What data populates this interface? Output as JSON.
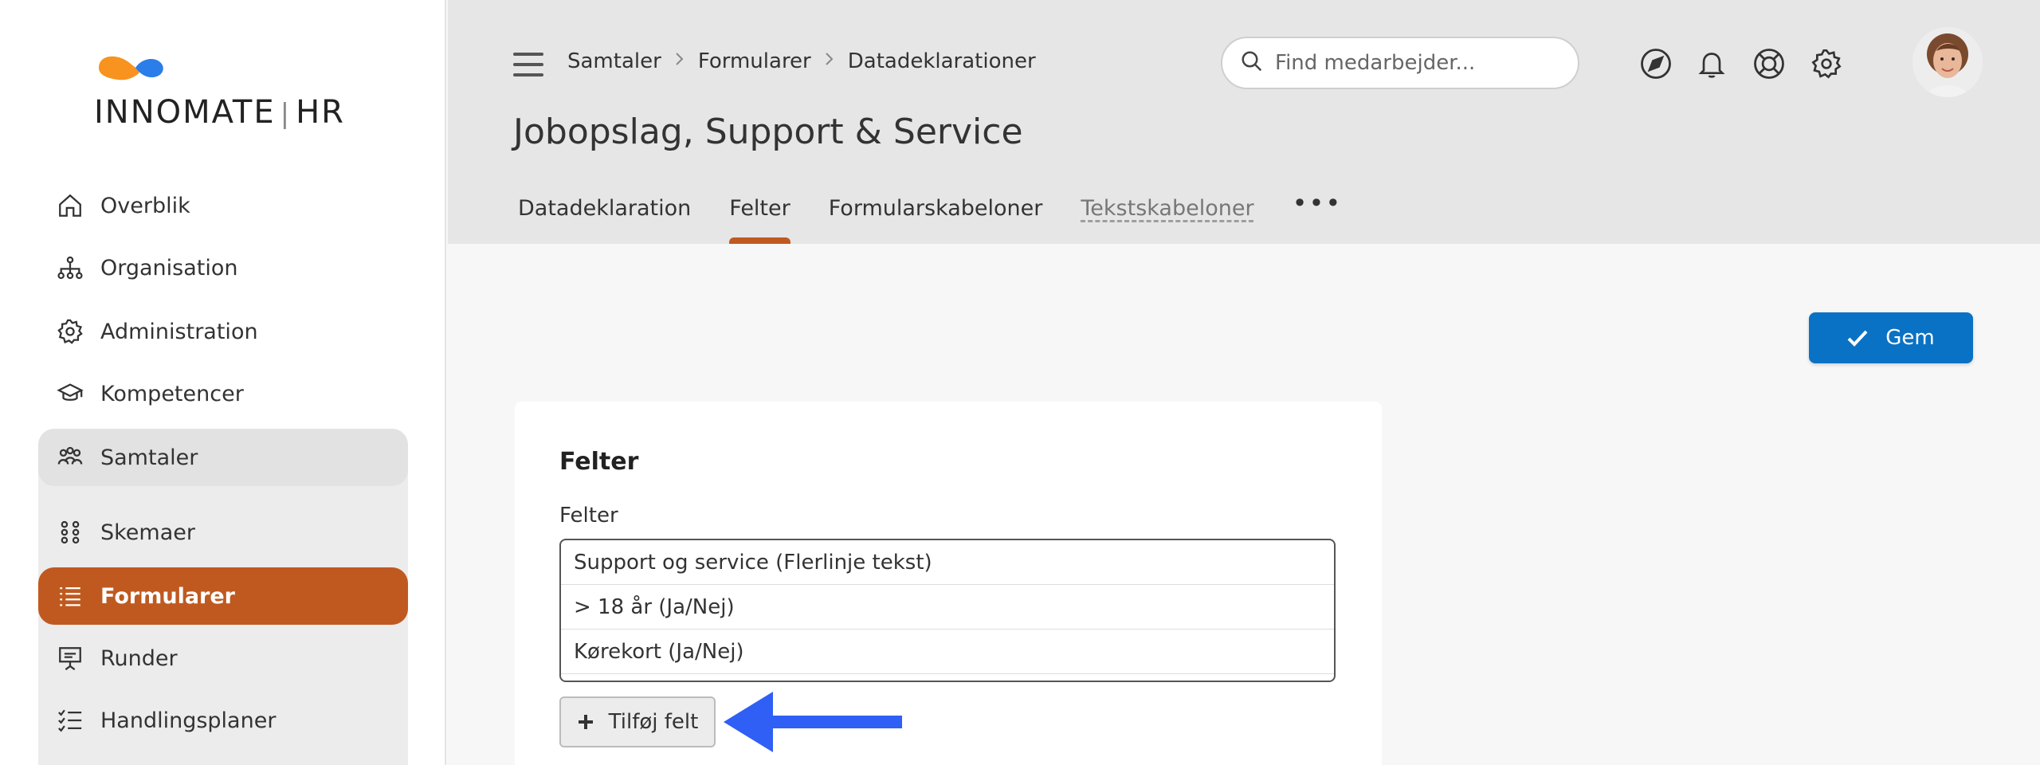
{
  "brand": {
    "name_left": "INNO",
    "name_right": "MATE",
    "separator": "|",
    "suffix": "HR",
    "colors": {
      "orange": "#f7931e",
      "blue": "#2b7de9"
    }
  },
  "sidebar": {
    "items": [
      {
        "label": "Overblik",
        "icon": "home-icon"
      },
      {
        "label": "Organisation",
        "icon": "org-chart-icon"
      },
      {
        "label": "Administration",
        "icon": "gear-icon"
      },
      {
        "label": "Kompetencer",
        "icon": "graduation-cap-icon"
      },
      {
        "label": "Samtaler",
        "icon": "people-icon"
      },
      {
        "label": "Skemaer",
        "icon": "grid-dots-icon"
      },
      {
        "label": "Formularer",
        "icon": "form-list-icon"
      },
      {
        "label": "Runder",
        "icon": "presentation-icon"
      },
      {
        "label": "Handlingsplaner",
        "icon": "checklist-icon"
      }
    ],
    "active_color": "#c0591f"
  },
  "header": {
    "breadcrumb": [
      "Samtaler",
      "Formularer",
      "Datadeklarationer"
    ],
    "title": "Jobopslag, Support & Service",
    "search": {
      "placeholder": "Find medarbejder..."
    },
    "icons": [
      "navigate-icon",
      "bell-icon",
      "lifebuoy-icon",
      "settings-icon"
    ],
    "tabs": [
      {
        "label": "Datadeklaration"
      },
      {
        "label": "Felter"
      },
      {
        "label": "Formularskabeloner"
      },
      {
        "label": "Tekstskabeloner"
      }
    ],
    "tabs_more": "•••"
  },
  "actions": {
    "save_label": "Gem",
    "save_color": "#0a72c4"
  },
  "card": {
    "title": "Felter",
    "field_label": "Felter",
    "fields": [
      "Support og service (Flerlinje tekst)",
      "> 18 år (Ja/Nej)",
      "Kørekort (Ja/Nej)"
    ],
    "add_label": "Tilføj felt"
  },
  "annotation": {
    "arrow_color": "#2f5ff5"
  }
}
